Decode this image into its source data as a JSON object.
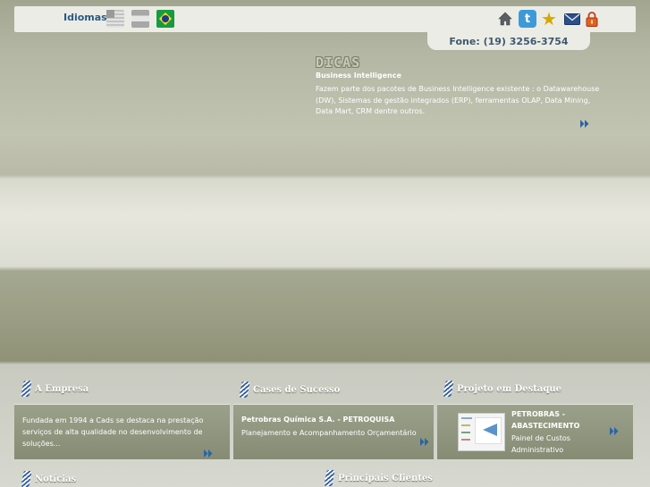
{
  "topbar": {
    "languages_label": "Idiomas:",
    "languages": [
      {
        "name": "English",
        "flag": "us-flag"
      },
      {
        "name": "Español",
        "flag": "es-flag"
      },
      {
        "name": "Português",
        "flag": "br-flag"
      }
    ],
    "icons": [
      "home-icon",
      "twitter-icon",
      "star-icon",
      "mail-icon",
      "lock-icon"
    ],
    "twitter_glyph": "t",
    "phone": "Fone: (19) 3256-3754"
  },
  "dicas": {
    "title": "DICAS",
    "subtitle": "Business Intelligence",
    "body": "Fazem parte dos pacotes de Business Intelligence existente : o Datawarehouse (DW), Sistemas de gestão integrados (ERP), ferramentas OLAP, Data Mining, Data Mart, CRM dentre outros."
  },
  "sections": {
    "empresa": {
      "heading": "A Empresa",
      "text": "Fundada em 1994 a Cads se destaca na prestação serviços de alta qualidade no desenvolvimento de soluções..."
    },
    "cases": {
      "heading": "Cases de Sucesso",
      "client": "Petrobras Química S.A. - PETROQUISA",
      "project": "Planejamento e Acompanhamento Orçamentário"
    },
    "destaque": {
      "heading": "Projeto em Destaque",
      "client": "PETROBRAS - ABASTECIMENTO",
      "project": "Painel de Custos Administrativo"
    },
    "noticias": {
      "heading": "Notícias"
    },
    "clientes": {
      "heading": "Principais Clientes"
    }
  },
  "colors": {
    "accent_blue": "#2b5a84",
    "arrow_blue": "#2a63a8"
  }
}
